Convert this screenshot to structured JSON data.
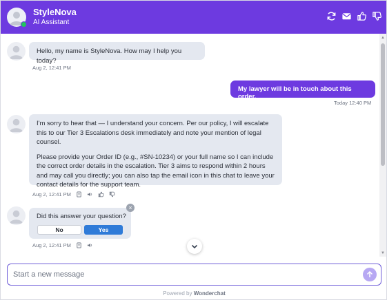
{
  "header": {
    "title": "StyleNova",
    "subtitle": "AI Assistant",
    "actions": [
      "refresh-icon",
      "email-icon",
      "thumbs-up-icon",
      "thumbs-down-icon"
    ]
  },
  "messages": [
    {
      "role": "assistant",
      "paragraphs": [
        "Hello, my name is StyleNova. How may I help you today?"
      ],
      "timestamp": "Aug 2, 12:41 PM"
    },
    {
      "role": "user",
      "text": "My lawyer will be in touch about this order.",
      "timestamp": "Today 12:40 PM"
    },
    {
      "role": "assistant",
      "paragraphs": [
        "I'm sorry to hear that — I understand your concern. Per our policy, I will escalate this to our Tier 3 Escalations desk immediately and note your mention of legal counsel.",
        "Please provide your Order ID (e.g., #SN-10234) or your full name so I can include the correct order details in the escalation. Tier 3 aims to respond within 2 hours and may call you directly; you can also tap the email icon in this chat to leave your contact details for the support team."
      ],
      "timestamp": "Aug 2, 12:41 PM"
    }
  ],
  "feedback": {
    "question": "Did this answer your question?",
    "no_label": "No",
    "yes_label": "Yes",
    "timestamp": "Aug 2, 12:41 PM"
  },
  "composer": {
    "placeholder": "Start a new message",
    "value": ""
  },
  "footer": {
    "prefix": "Powered by",
    "brand": "Wonderchat"
  },
  "colors": {
    "brand": "#6d3ae0",
    "bubble": "#e4e8f0",
    "yes_button": "#2f7bd8",
    "online": "#22c55e"
  }
}
